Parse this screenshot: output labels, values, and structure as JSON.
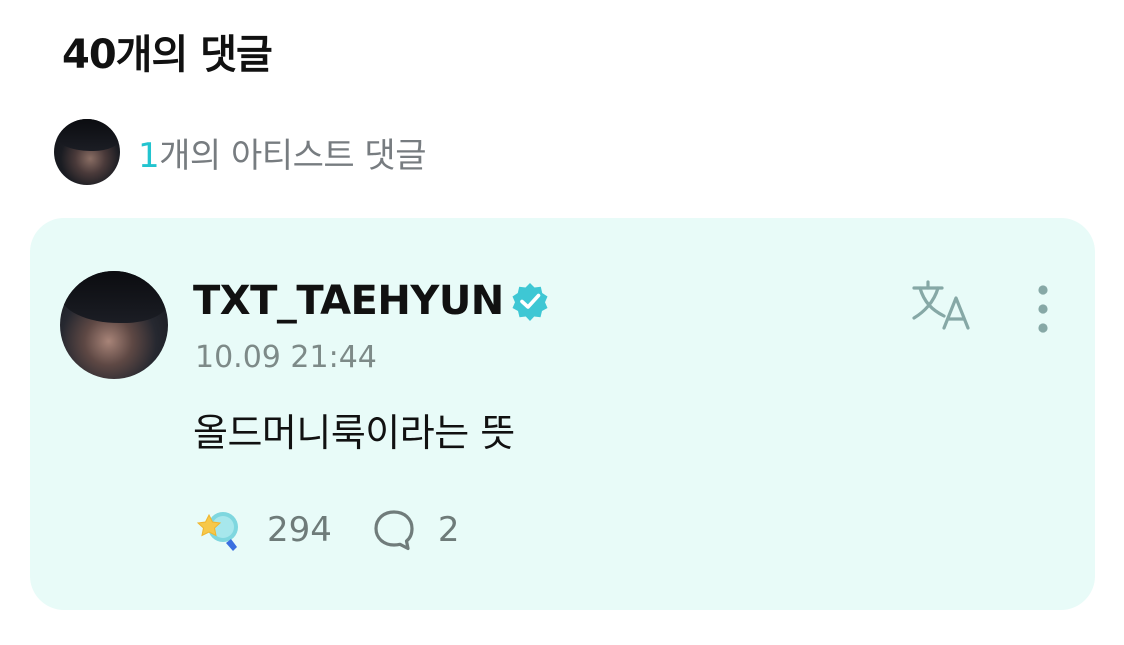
{
  "header": {
    "title": "40개의 댓글"
  },
  "artist_summary": {
    "count": "1",
    "label": "개의 아티스트 댓글"
  },
  "comment": {
    "username": "TXT_TAEHYUN",
    "timestamp": "10.09 21:44",
    "text": "올드머니룩이라는 뜻",
    "likes": "294",
    "replies": "2",
    "verified": true
  },
  "icons": {
    "verified": "verified-badge-icon",
    "translate": "translate-icon",
    "more": "more-vertical-icon",
    "like": "star-cheer-icon",
    "reply": "speech-bubble-icon"
  },
  "colors": {
    "accent": "#22c4cf",
    "card_bg": "#e8fbf8",
    "muted": "#7d8a88"
  }
}
